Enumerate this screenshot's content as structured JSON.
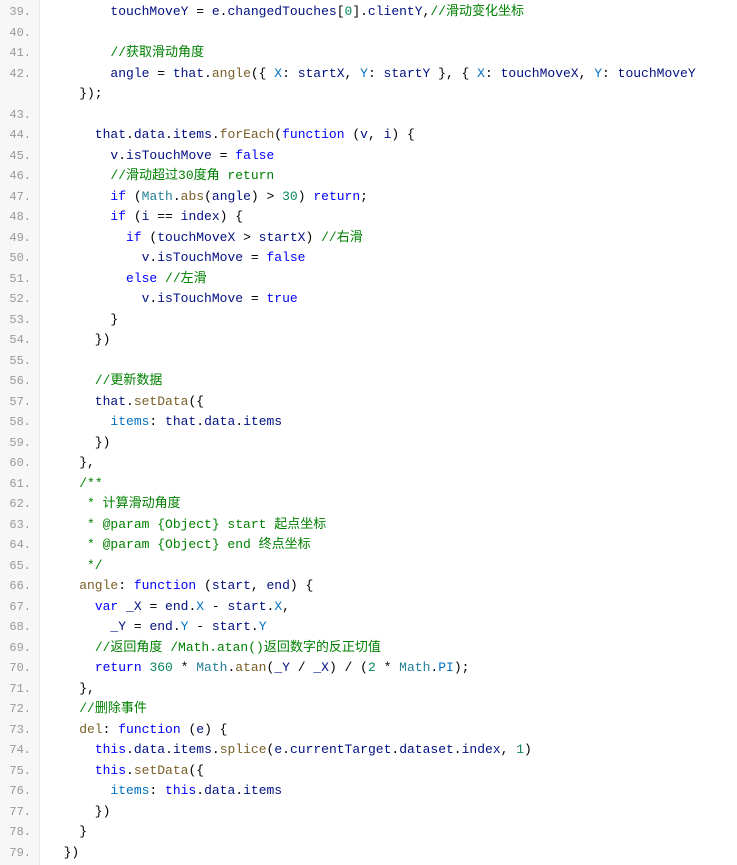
{
  "editor": {
    "startLine": 39,
    "endLine": 79,
    "lines": [
      {
        "num": "39.",
        "tokens": [
          {
            "t": "        touchMoveY ",
            "c": "id"
          },
          {
            "t": "= ",
            "c": "op"
          },
          {
            "t": "e",
            "c": "id"
          },
          {
            "t": ".",
            "c": "p"
          },
          {
            "t": "changedTouches",
            "c": "id"
          },
          {
            "t": "[",
            "c": "p"
          },
          {
            "t": "0",
            "c": "n"
          },
          {
            "t": "].",
            "c": "p"
          },
          {
            "t": "clientY",
            "c": "id"
          },
          {
            "t": ",",
            "c": "p"
          },
          {
            "t": "//滑动变化坐标",
            "c": "c"
          }
        ]
      },
      {
        "num": "40.",
        "tokens": []
      },
      {
        "num": "41.",
        "tokens": [
          {
            "t": "        ",
            "c": "p"
          },
          {
            "t": "//获取滑动角度",
            "c": "c"
          }
        ]
      },
      {
        "num": "42.",
        "tokens": [
          {
            "t": "        angle ",
            "c": "id"
          },
          {
            "t": "= ",
            "c": "op"
          },
          {
            "t": "that",
            "c": "id"
          },
          {
            "t": ".",
            "c": "p"
          },
          {
            "t": "angle",
            "c": "d"
          },
          {
            "t": "({ ",
            "c": "p"
          },
          {
            "t": "X",
            "c": "pr"
          },
          {
            "t": ": ",
            "c": "p"
          },
          {
            "t": "startX",
            "c": "id"
          },
          {
            "t": ", ",
            "c": "p"
          },
          {
            "t": "Y",
            "c": "pr"
          },
          {
            "t": ": ",
            "c": "p"
          },
          {
            "t": "startY ",
            "c": "id"
          },
          {
            "t": "}, { ",
            "c": "p"
          },
          {
            "t": "X",
            "c": "pr"
          },
          {
            "t": ": ",
            "c": "p"
          },
          {
            "t": "touchMoveX",
            "c": "id"
          },
          {
            "t": ", ",
            "c": "p"
          },
          {
            "t": "Y",
            "c": "pr"
          },
          {
            "t": ": ",
            "c": "p"
          },
          {
            "t": "touchMoveY ",
            "c": "id"
          }
        ]
      },
      {
        "num": "",
        "tokens": [
          {
            "t": "    });",
            "c": "p"
          }
        ]
      },
      {
        "num": "43.",
        "tokens": []
      },
      {
        "num": "44.",
        "tokens": [
          {
            "t": "      that",
            "c": "id"
          },
          {
            "t": ".",
            "c": "p"
          },
          {
            "t": "data",
            "c": "id"
          },
          {
            "t": ".",
            "c": "p"
          },
          {
            "t": "items",
            "c": "id"
          },
          {
            "t": ".",
            "c": "p"
          },
          {
            "t": "forEach",
            "c": "d"
          },
          {
            "t": "(",
            "c": "p"
          },
          {
            "t": "function",
            "c": "k"
          },
          {
            "t": " (",
            "c": "p"
          },
          {
            "t": "v",
            "c": "id"
          },
          {
            "t": ", ",
            "c": "p"
          },
          {
            "t": "i",
            "c": "id"
          },
          {
            "t": ") {",
            "c": "p"
          }
        ]
      },
      {
        "num": "45.",
        "tokens": [
          {
            "t": "        v",
            "c": "id"
          },
          {
            "t": ".",
            "c": "p"
          },
          {
            "t": "isTouchMove ",
            "c": "id"
          },
          {
            "t": "= ",
            "c": "op"
          },
          {
            "t": "false",
            "c": "k"
          }
        ]
      },
      {
        "num": "46.",
        "tokens": [
          {
            "t": "        ",
            "c": "p"
          },
          {
            "t": "//滑动超过30度角 return",
            "c": "c"
          }
        ]
      },
      {
        "num": "47.",
        "tokens": [
          {
            "t": "        ",
            "c": "p"
          },
          {
            "t": "if",
            "c": "k"
          },
          {
            "t": " (",
            "c": "p"
          },
          {
            "t": "Math",
            "c": "t"
          },
          {
            "t": ".",
            "c": "p"
          },
          {
            "t": "abs",
            "c": "d"
          },
          {
            "t": "(",
            "c": "p"
          },
          {
            "t": "angle",
            "c": "id"
          },
          {
            "t": ") > ",
            "c": "op"
          },
          {
            "t": "30",
            "c": "n"
          },
          {
            "t": ") ",
            "c": "p"
          },
          {
            "t": "return",
            "c": "k"
          },
          {
            "t": ";",
            "c": "p"
          }
        ]
      },
      {
        "num": "48.",
        "tokens": [
          {
            "t": "        ",
            "c": "p"
          },
          {
            "t": "if",
            "c": "k"
          },
          {
            "t": " (",
            "c": "p"
          },
          {
            "t": "i ",
            "c": "id"
          },
          {
            "t": "== ",
            "c": "op"
          },
          {
            "t": "index",
            "c": "id"
          },
          {
            "t": ") {",
            "c": "p"
          }
        ]
      },
      {
        "num": "49.",
        "tokens": [
          {
            "t": "          ",
            "c": "p"
          },
          {
            "t": "if",
            "c": "k"
          },
          {
            "t": " (",
            "c": "p"
          },
          {
            "t": "touchMoveX ",
            "c": "id"
          },
          {
            "t": "> ",
            "c": "op"
          },
          {
            "t": "startX",
            "c": "id"
          },
          {
            "t": ") ",
            "c": "p"
          },
          {
            "t": "//右滑",
            "c": "c"
          }
        ]
      },
      {
        "num": "50.",
        "tokens": [
          {
            "t": "            v",
            "c": "id"
          },
          {
            "t": ".",
            "c": "p"
          },
          {
            "t": "isTouchMove ",
            "c": "id"
          },
          {
            "t": "= ",
            "c": "op"
          },
          {
            "t": "false",
            "c": "k"
          }
        ]
      },
      {
        "num": "51.",
        "tokens": [
          {
            "t": "          ",
            "c": "p"
          },
          {
            "t": "else",
            "c": "k"
          },
          {
            "t": " ",
            "c": "p"
          },
          {
            "t": "//左滑",
            "c": "c"
          }
        ]
      },
      {
        "num": "52.",
        "tokens": [
          {
            "t": "            v",
            "c": "id"
          },
          {
            "t": ".",
            "c": "p"
          },
          {
            "t": "isTouchMove ",
            "c": "id"
          },
          {
            "t": "= ",
            "c": "op"
          },
          {
            "t": "true",
            "c": "k"
          }
        ]
      },
      {
        "num": "53.",
        "tokens": [
          {
            "t": "        }",
            "c": "p"
          }
        ]
      },
      {
        "num": "54.",
        "tokens": [
          {
            "t": "      })",
            "c": "p"
          }
        ]
      },
      {
        "num": "55.",
        "tokens": []
      },
      {
        "num": "56.",
        "tokens": [
          {
            "t": "      ",
            "c": "p"
          },
          {
            "t": "//更新数据",
            "c": "c"
          }
        ]
      },
      {
        "num": "57.",
        "tokens": [
          {
            "t": "      that",
            "c": "id"
          },
          {
            "t": ".",
            "c": "p"
          },
          {
            "t": "setData",
            "c": "d"
          },
          {
            "t": "({",
            "c": "p"
          }
        ]
      },
      {
        "num": "58.",
        "tokens": [
          {
            "t": "        items",
            "c": "pr"
          },
          {
            "t": ": ",
            "c": "p"
          },
          {
            "t": "that",
            "c": "id"
          },
          {
            "t": ".",
            "c": "p"
          },
          {
            "t": "data",
            "c": "id"
          },
          {
            "t": ".",
            "c": "p"
          },
          {
            "t": "items",
            "c": "id"
          }
        ]
      },
      {
        "num": "59.",
        "tokens": [
          {
            "t": "      })",
            "c": "p"
          }
        ]
      },
      {
        "num": "60.",
        "tokens": [
          {
            "t": "    },",
            "c": "p"
          }
        ]
      },
      {
        "num": "61.",
        "tokens": [
          {
            "t": "    ",
            "c": "p"
          },
          {
            "t": "/**",
            "c": "c"
          }
        ]
      },
      {
        "num": "62.",
        "tokens": [
          {
            "t": "     * 计算滑动角度",
            "c": "c"
          }
        ]
      },
      {
        "num": "63.",
        "tokens": [
          {
            "t": "     * @param {Object} start 起点坐标",
            "c": "c"
          }
        ]
      },
      {
        "num": "64.",
        "tokens": [
          {
            "t": "     * @param {Object} end 终点坐标",
            "c": "c"
          }
        ]
      },
      {
        "num": "65.",
        "tokens": [
          {
            "t": "     */",
            "c": "c"
          }
        ]
      },
      {
        "num": "66.",
        "tokens": [
          {
            "t": "    angle",
            "c": "d"
          },
          {
            "t": ": ",
            "c": "p"
          },
          {
            "t": "function",
            "c": "k"
          },
          {
            "t": " (",
            "c": "p"
          },
          {
            "t": "start",
            "c": "id"
          },
          {
            "t": ", ",
            "c": "p"
          },
          {
            "t": "end",
            "c": "id"
          },
          {
            "t": ") {",
            "c": "p"
          }
        ]
      },
      {
        "num": "67.",
        "tokens": [
          {
            "t": "      ",
            "c": "p"
          },
          {
            "t": "var",
            "c": "k"
          },
          {
            "t": " _X ",
            "c": "id"
          },
          {
            "t": "= ",
            "c": "op"
          },
          {
            "t": "end",
            "c": "id"
          },
          {
            "t": ".",
            "c": "p"
          },
          {
            "t": "X ",
            "c": "pr"
          },
          {
            "t": "- ",
            "c": "op"
          },
          {
            "t": "start",
            "c": "id"
          },
          {
            "t": ".",
            "c": "p"
          },
          {
            "t": "X",
            "c": "pr"
          },
          {
            "t": ",",
            "c": "p"
          }
        ]
      },
      {
        "num": "68.",
        "tokens": [
          {
            "t": "        _Y ",
            "c": "id"
          },
          {
            "t": "= ",
            "c": "op"
          },
          {
            "t": "end",
            "c": "id"
          },
          {
            "t": ".",
            "c": "p"
          },
          {
            "t": "Y ",
            "c": "pr"
          },
          {
            "t": "- ",
            "c": "op"
          },
          {
            "t": "start",
            "c": "id"
          },
          {
            "t": ".",
            "c": "p"
          },
          {
            "t": "Y",
            "c": "pr"
          }
        ]
      },
      {
        "num": "69.",
        "tokens": [
          {
            "t": "      ",
            "c": "p"
          },
          {
            "t": "//返回角度 /Math.atan()返回数字的反正切值",
            "c": "c"
          }
        ]
      },
      {
        "num": "70.",
        "tokens": [
          {
            "t": "      ",
            "c": "p"
          },
          {
            "t": "return",
            "c": "k"
          },
          {
            "t": " ",
            "c": "p"
          },
          {
            "t": "360",
            "c": "n"
          },
          {
            "t": " * ",
            "c": "op"
          },
          {
            "t": "Math",
            "c": "t"
          },
          {
            "t": ".",
            "c": "p"
          },
          {
            "t": "atan",
            "c": "d"
          },
          {
            "t": "(",
            "c": "p"
          },
          {
            "t": "_Y ",
            "c": "id"
          },
          {
            "t": "/ ",
            "c": "op"
          },
          {
            "t": "_X",
            "c": "id"
          },
          {
            "t": ") / (",
            "c": "p"
          },
          {
            "t": "2",
            "c": "n"
          },
          {
            "t": " * ",
            "c": "op"
          },
          {
            "t": "Math",
            "c": "t"
          },
          {
            "t": ".",
            "c": "p"
          },
          {
            "t": "PI",
            "c": "pr"
          },
          {
            "t": ");",
            "c": "p"
          }
        ]
      },
      {
        "num": "71.",
        "tokens": [
          {
            "t": "    },",
            "c": "p"
          }
        ]
      },
      {
        "num": "72.",
        "tokens": [
          {
            "t": "    ",
            "c": "p"
          },
          {
            "t": "//删除事件",
            "c": "c"
          }
        ]
      },
      {
        "num": "73.",
        "tokens": [
          {
            "t": "    del",
            "c": "d"
          },
          {
            "t": ": ",
            "c": "p"
          },
          {
            "t": "function",
            "c": "k"
          },
          {
            "t": " (",
            "c": "p"
          },
          {
            "t": "e",
            "c": "id"
          },
          {
            "t": ") {",
            "c": "p"
          }
        ]
      },
      {
        "num": "74.",
        "tokens": [
          {
            "t": "      ",
            "c": "p"
          },
          {
            "t": "this",
            "c": "k"
          },
          {
            "t": ".",
            "c": "p"
          },
          {
            "t": "data",
            "c": "id"
          },
          {
            "t": ".",
            "c": "p"
          },
          {
            "t": "items",
            "c": "id"
          },
          {
            "t": ".",
            "c": "p"
          },
          {
            "t": "splice",
            "c": "d"
          },
          {
            "t": "(",
            "c": "p"
          },
          {
            "t": "e",
            "c": "id"
          },
          {
            "t": ".",
            "c": "p"
          },
          {
            "t": "currentTarget",
            "c": "id"
          },
          {
            "t": ".",
            "c": "p"
          },
          {
            "t": "dataset",
            "c": "id"
          },
          {
            "t": ".",
            "c": "p"
          },
          {
            "t": "index",
            "c": "id"
          },
          {
            "t": ", ",
            "c": "p"
          },
          {
            "t": "1",
            "c": "n"
          },
          {
            "t": ")",
            "c": "p"
          }
        ]
      },
      {
        "num": "75.",
        "tokens": [
          {
            "t": "      ",
            "c": "p"
          },
          {
            "t": "this",
            "c": "k"
          },
          {
            "t": ".",
            "c": "p"
          },
          {
            "t": "setData",
            "c": "d"
          },
          {
            "t": "({",
            "c": "p"
          }
        ]
      },
      {
        "num": "76.",
        "tokens": [
          {
            "t": "        items",
            "c": "pr"
          },
          {
            "t": ": ",
            "c": "p"
          },
          {
            "t": "this",
            "c": "k"
          },
          {
            "t": ".",
            "c": "p"
          },
          {
            "t": "data",
            "c": "id"
          },
          {
            "t": ".",
            "c": "p"
          },
          {
            "t": "items",
            "c": "id"
          }
        ]
      },
      {
        "num": "77.",
        "tokens": [
          {
            "t": "      })",
            "c": "p"
          }
        ]
      },
      {
        "num": "78.",
        "tokens": [
          {
            "t": "    }",
            "c": "p"
          }
        ]
      },
      {
        "num": "79.",
        "tokens": [
          {
            "t": "  })",
            "c": "p"
          }
        ]
      }
    ]
  }
}
